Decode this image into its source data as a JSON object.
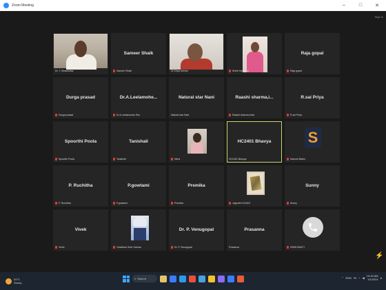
{
  "window": {
    "title": "Zoom Meeting",
    "controls": [
      "–",
      "□",
      "✕"
    ],
    "signin_hint": "Sign in"
  },
  "participants": [
    {
      "tile_name": "",
      "label": "Dr. T. Shashidhar",
      "muted": false,
      "kind": "video"
    },
    {
      "tile_name": "Sameer Shaik",
      "label": "Sameer Shaik",
      "muted": true,
      "kind": "name"
    },
    {
      "tile_name": "",
      "label": "Dr Kripa Sekhar",
      "muted": false,
      "kind": "video"
    },
    {
      "tile_name": "",
      "label": "Sheik Haseena",
      "muted": true,
      "kind": "video"
    },
    {
      "tile_name": "Raja gopal",
      "label": "Raja gopal",
      "muted": true,
      "kind": "name"
    },
    {
      "tile_name": "Durga prasad",
      "label": "Durga prasad",
      "muted": true,
      "kind": "name"
    },
    {
      "tile_name": "Dr.A.Leelamohe...",
      "label": "Dr.A.Leelamohan Rao",
      "muted": true,
      "kind": "name"
    },
    {
      "tile_name": "Natural star Nani",
      "label": "Natural star Nani",
      "muted": false,
      "kind": "name"
    },
    {
      "tile_name": "Raashi  sharma,i...",
      "label": "Raashi sharma india",
      "muted": true,
      "kind": "name"
    },
    {
      "tile_name": "R.sai Priya",
      "label": "R.sai Priya",
      "muted": true,
      "kind": "name"
    },
    {
      "tile_name": "Spoorthi Poola",
      "label": "Spoorthi Poola",
      "muted": true,
      "kind": "name"
    },
    {
      "tile_name": "Tanishali",
      "label": "Tanishali",
      "muted": true,
      "kind": "name"
    },
    {
      "tile_name": "",
      "label": "Neha",
      "muted": true,
      "kind": "picture-girl"
    },
    {
      "tile_name": "HC2401 Bhavya",
      "label": "HC2401 Bhavya",
      "muted": false,
      "kind": "name",
      "active": true
    },
    {
      "tile_name": "",
      "label": "Samuel Babm",
      "muted": true,
      "kind": "picture-logo"
    },
    {
      "tile_name": "P. Ruchitha",
      "label": "P. Ruchitha",
      "muted": true,
      "kind": "name"
    },
    {
      "tile_name": "P.gowtami",
      "label": "P.gowtami",
      "muted": true,
      "kind": "name"
    },
    {
      "tile_name": "Premika",
      "label": "Premika",
      "muted": true,
      "kind": "name"
    },
    {
      "tile_name": "",
      "label": "Jagruthi HC2402",
      "muted": true,
      "kind": "picture-art"
    },
    {
      "tile_name": "Sunny",
      "label": "Sunny",
      "muted": true,
      "kind": "name"
    },
    {
      "tile_name": "Vivek",
      "label": "Vivek",
      "muted": true,
      "kind": "name"
    },
    {
      "tile_name": "",
      "label": "Gowtham Sree Harsha",
      "muted": true,
      "kind": "picture-anime"
    },
    {
      "tile_name": "Dr. P. Venugopal",
      "label": "Dr. P. Venugopal",
      "muted": true,
      "kind": "name"
    },
    {
      "tile_name": "Prasanna",
      "label": "Prasanna",
      "muted": false,
      "kind": "name"
    },
    {
      "tile_name": "",
      "label": "09951256477",
      "muted": true,
      "kind": "picture-phone"
    }
  ],
  "taskbar": {
    "weather_temp": "31°C",
    "weather_desc": "Sunny",
    "search_label": "Search",
    "tray_lang": "ENG",
    "tray_region": "IN",
    "time": "10:49 AM",
    "date": "1/1/2024"
  },
  "colors": {
    "active_border": "#c8d66c",
    "muted_mic": "#e23b3b",
    "accent": "#2d8cff"
  }
}
